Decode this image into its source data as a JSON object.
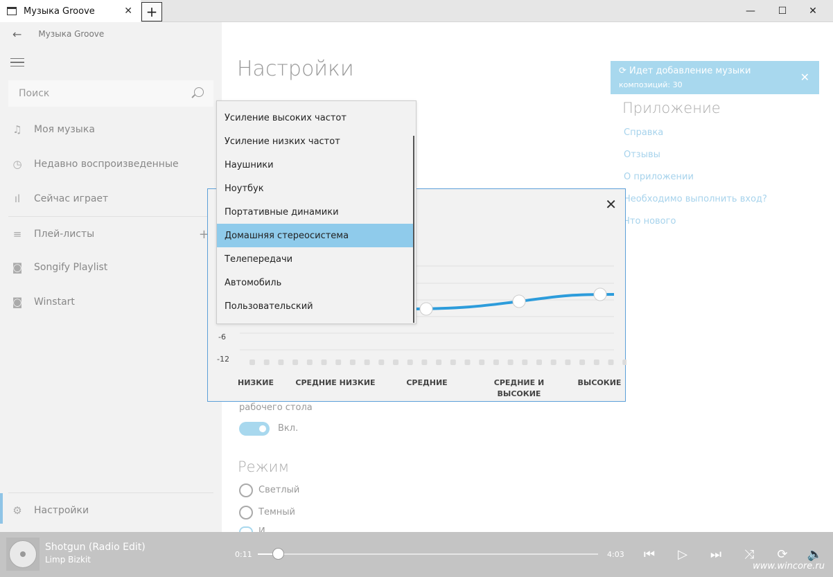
{
  "window": {
    "tab_title": "Музыка Groove",
    "tab_close": "✕",
    "new_tab": "+",
    "minimize": "—",
    "maximize": "☐",
    "close": "✕"
  },
  "sidebar": {
    "back_label": "Музыка Groove",
    "search_placeholder": "Поиск",
    "items": [
      {
        "label": "Моя музыка",
        "icon": "♫"
      },
      {
        "label": "Недавно воспроизведенные",
        "icon": "◷"
      },
      {
        "label": "Сейчас играет",
        "icon": "ıl"
      },
      {
        "label": "Плей-листы",
        "icon": "≡"
      },
      {
        "label": "Songify Playlist",
        "icon": "◙"
      },
      {
        "label": "Winstart",
        "icon": "◙"
      }
    ],
    "add_label": "+",
    "settings_label": "Настройки",
    "settings_icon": "⚙"
  },
  "main": {
    "title": "Настройки",
    "notification": {
      "title": "Идет добавление музыки",
      "subtitle": "композиций: 30",
      "icon": "⟳",
      "close": "✕"
    },
    "app_section": {
      "heading": "Приложение",
      "links": [
        "Справка",
        "Отзывы",
        "О приложении",
        "Необходимо выполнить вход?",
        "Что нового"
      ]
    },
    "desktop_text": "рабочего стола",
    "toggle_label": "Вкл.",
    "mode_heading": "Режим",
    "modes": [
      "Светлый",
      "Темный",
      "И"
    ]
  },
  "equalizer": {
    "close": "✕",
    "ticks": [
      "-6",
      "-12"
    ],
    "bands": [
      "НИЗКИЕ",
      "СРЕДНИЕ НИЗКИЕ",
      "СРЕДНИЕ",
      "СРЕДНИЕ И ВЫСОКИЕ",
      "ВЫСОКИЕ"
    ],
    "accent_color": "#2d9cdb"
  },
  "preset_dropdown": {
    "items": [
      "Усиление высоких частот",
      "Усиление низких частот",
      "Наушники",
      "Ноутбук",
      "Портативные динамики",
      "Домашняя стереосистема",
      "Телепередачи",
      "Автомобиль",
      "Пользовательский"
    ],
    "selected": "Домашняя стереосистема"
  },
  "player": {
    "song": "Shotgun (Radio Edit)",
    "artist": "Limp Bizkit",
    "elapsed": "0:11",
    "duration": "4:03",
    "progress": 0.045,
    "icons": {
      "previous": "⏮",
      "play": "▷",
      "next": "⏭",
      "shuffle": "⤨",
      "repeat": "⟳",
      "volume": "🔈"
    },
    "watermark": "www.wincore.ru"
  }
}
